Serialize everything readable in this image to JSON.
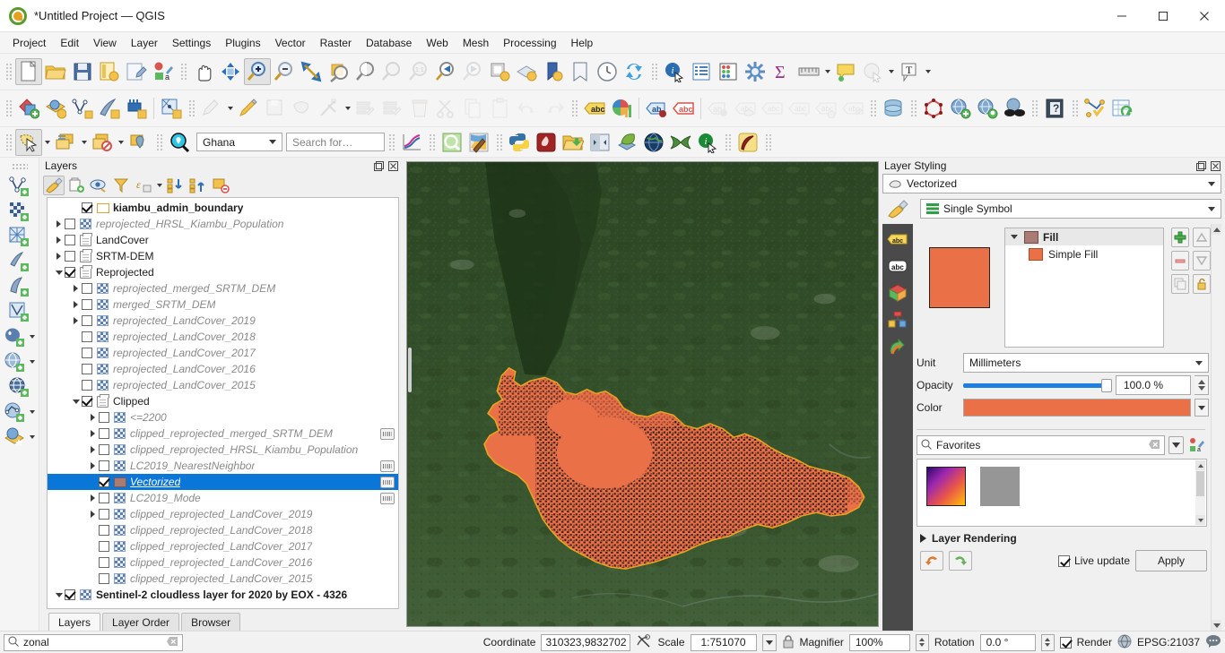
{
  "window": {
    "title": "*Untitled Project — QGIS",
    "logo_icon": "qgis-logo-icon",
    "minimize_icon": "minimize-icon",
    "maximize_icon": "maximize-icon",
    "close_icon": "close-icon"
  },
  "menubar": [
    {
      "label": "Project"
    },
    {
      "label": "Edit"
    },
    {
      "label": "View"
    },
    {
      "label": "Layer"
    },
    {
      "label": "Settings"
    },
    {
      "label": "Plugins"
    },
    {
      "label": "Vector"
    },
    {
      "label": "Raster"
    },
    {
      "label": "Database"
    },
    {
      "label": "Web"
    },
    {
      "label": "Mesh"
    },
    {
      "label": "Processing"
    },
    {
      "label": "Help"
    }
  ],
  "toolbar_row1": [
    {
      "icon": "new-project-icon",
      "active": true
    },
    {
      "icon": "open-project-icon"
    },
    {
      "icon": "save-project-icon"
    },
    {
      "icon": "save-project-as-icon"
    },
    {
      "icon": "new-print-layout-icon"
    },
    {
      "icon": "style-manager-icon"
    },
    {
      "icon": "pan-map-icon"
    },
    {
      "icon": "pan-to-selection-icon"
    },
    {
      "icon": "zoom-in-icon",
      "active": true
    },
    {
      "icon": "zoom-out-icon"
    },
    {
      "icon": "zoom-full-icon"
    },
    {
      "icon": "zoom-to-selection-icon"
    },
    {
      "icon": "zoom-to-layer-icon"
    },
    {
      "icon": "zoom-native-resolution-icon"
    },
    {
      "icon": "zoom-last-icon"
    },
    {
      "icon": "zoom-next-icon"
    },
    {
      "icon": "new-map-view-icon"
    },
    {
      "icon": "new-3d-map-view-icon"
    },
    {
      "icon": "show-bookmarks-icon"
    },
    {
      "icon": "new-bookmark-icon"
    },
    {
      "icon": "temporal-controller-icon"
    },
    {
      "icon": "refresh-icon"
    },
    {
      "icon": "identify-features-icon"
    },
    {
      "icon": "open-attribute-table-icon"
    },
    {
      "icon": "statistical-summary-icon"
    },
    {
      "icon": "processing-toolbox-icon"
    },
    {
      "icon": "sum-field-icon"
    },
    {
      "icon": "measure-line-icon"
    },
    {
      "icon": "map-tips-icon"
    },
    {
      "icon": "show-annotations-icon"
    },
    {
      "icon": "text-annotation-icon"
    }
  ],
  "toolbar_row2": [
    {
      "icon": "add-vector-layer-icon"
    },
    {
      "icon": "add-raster-layer-icon"
    },
    {
      "icon": "add-delimited-text-layer-icon"
    },
    {
      "icon": "add-spatialite-layer-icon"
    },
    {
      "icon": "add-virtual-layer-icon"
    },
    {
      "icon": "add-mesh-layer-icon"
    },
    {
      "icon": "current-edits-icon"
    },
    {
      "icon": "toggle-editing-icon"
    },
    {
      "icon": "save-layer-edits-icon"
    },
    {
      "icon": "add-polygon-feature-icon"
    },
    {
      "icon": "vertex-tool-icon"
    },
    {
      "icon": "modify-attributes-icon"
    },
    {
      "icon": "multi-edit-icon"
    },
    {
      "icon": "delete-selected-icon"
    },
    {
      "icon": "cut-features-icon"
    },
    {
      "icon": "copy-features-icon"
    },
    {
      "icon": "paste-features-icon"
    },
    {
      "icon": "undo-icon"
    },
    {
      "icon": "redo-icon"
    },
    {
      "icon": "label-layer-icon"
    },
    {
      "icon": "diagram-icon"
    },
    {
      "icon": "pin-labels-icon"
    },
    {
      "icon": "highlight-labels-icon"
    },
    {
      "icon": "move-label-icon"
    },
    {
      "icon": "show-hide-labels-icon"
    },
    {
      "icon": "rotate-label-icon"
    },
    {
      "icon": "change-label-icon"
    },
    {
      "icon": "label-properties-icon"
    },
    {
      "icon": "edit-label-icon"
    },
    {
      "icon": "database-manager-icon"
    },
    {
      "icon": "geometry-checker-icon"
    },
    {
      "icon": "metasearch-add-icon"
    },
    {
      "icon": "metasearch-find-icon"
    },
    {
      "icon": "openstreetmap-icon"
    },
    {
      "icon": "help-contents-icon"
    },
    {
      "icon": "topology-checker-icon"
    },
    {
      "icon": "refresh-table-icon"
    }
  ],
  "toolbar_row3": {
    "left_buttons": [
      {
        "icon": "select-features-icon",
        "active": true
      },
      {
        "icon": "deselect-features-icon"
      },
      {
        "icon": "select-by-expression-icon"
      },
      {
        "icon": "select-by-location-icon"
      }
    ],
    "search_zone_icon": "magnifier-blue-icon",
    "country_combo": {
      "value": "Ghana",
      "options": [
        "Ghana"
      ]
    },
    "search_input": {
      "value": "",
      "placeholder": "Search for…"
    },
    "right_buttons": [
      {
        "icon": "plot-chart-icon"
      },
      {
        "icon": "zoom-green-icon"
      },
      {
        "icon": "paint-style-icon"
      },
      {
        "icon": "python-console-icon"
      },
      {
        "icon": "freehand-red-icon"
      },
      {
        "icon": "open-folder-icon"
      },
      {
        "icon": "compare-split-icon"
      },
      {
        "icon": "leaf-layers-icon"
      },
      {
        "icon": "globe-dark-icon"
      },
      {
        "icon": "green-bowtie-icon"
      },
      {
        "icon": "info-green-icon"
      },
      {
        "icon": "lasso-yellow-icon"
      }
    ]
  },
  "left_dock": [
    {
      "icon": "add-vector-layer-icon",
      "caret": false
    },
    {
      "icon": "add-raster-layer-icon",
      "caret": false
    },
    {
      "icon": "add-mesh-layer-icon",
      "caret": false
    },
    {
      "icon": "add-delimited-text-layer-icon",
      "caret": false
    },
    {
      "icon": "add-spatialite-layer-icon",
      "caret": false
    },
    {
      "icon": "add-virtual-layer-icon",
      "caret": false
    },
    {
      "icon": "add-postgis-layer-icon",
      "caret": true
    },
    {
      "icon": "add-wms-layer-icon",
      "caret": true
    },
    {
      "icon": "add-wcs-layer-icon",
      "caret": false
    },
    {
      "icon": "add-wfs-layer-icon",
      "caret": true
    },
    {
      "icon": "add-arcgis-layer-icon",
      "caret": true
    }
  ],
  "layers_panel": {
    "title": "Layers",
    "float_icon": "undock-icon",
    "close_icon": "close-panel-icon",
    "toolbar": [
      {
        "icon": "open-layer-styling-icon",
        "active": true
      },
      {
        "icon": "add-group-icon",
        "active": false
      },
      {
        "icon": "manage-map-themes-icon",
        "active": false
      },
      {
        "icon": "filter-legend-icon",
        "active": false
      },
      {
        "icon": "filter-legend-expression-icon",
        "active": false,
        "caret": true
      },
      {
        "icon": "expand-all-icon",
        "active": false
      },
      {
        "icon": "collapse-all-icon",
        "active": false
      },
      {
        "icon": "remove-layer-icon",
        "active": false
      }
    ],
    "tree": [
      {
        "name": "kiambu_admin_boundary",
        "indent": 1,
        "checked": true,
        "expander": "none",
        "icon": "empty-polygon-swatch",
        "style": "bold",
        "chip": false
      },
      {
        "name": "reprojected_HRSL_Kiambu_Population",
        "indent": 0,
        "checked": false,
        "expander": "collapsed",
        "icon": "raster",
        "style": "italic-grey",
        "chip": false
      },
      {
        "name": "LandCover",
        "indent": 0,
        "checked": false,
        "expander": "collapsed",
        "icon": "group",
        "style": "plain",
        "chip": false
      },
      {
        "name": "SRTM-DEM",
        "indent": 0,
        "checked": false,
        "expander": "collapsed",
        "icon": "group",
        "style": "plain",
        "chip": false
      },
      {
        "name": "Reprojected",
        "indent": 0,
        "checked": true,
        "expander": "expanded",
        "icon": "group",
        "style": "plain",
        "chip": false
      },
      {
        "name": "reprojected_merged_SRTM_DEM",
        "indent": 1,
        "checked": false,
        "expander": "collapsed",
        "icon": "raster",
        "style": "italic-grey",
        "chip": false
      },
      {
        "name": "merged_SRTM_DEM",
        "indent": 1,
        "checked": false,
        "expander": "collapsed",
        "icon": "raster",
        "style": "italic-grey",
        "chip": false
      },
      {
        "name": "reprojected_LandCover_2019",
        "indent": 1,
        "checked": false,
        "expander": "collapsed",
        "icon": "raster",
        "style": "italic-grey",
        "chip": false
      },
      {
        "name": "reprojected_LandCover_2018",
        "indent": 1,
        "checked": false,
        "expander": "none",
        "icon": "raster",
        "style": "italic-grey",
        "chip": false
      },
      {
        "name": "reprojected_LandCover_2017",
        "indent": 1,
        "checked": false,
        "expander": "none",
        "icon": "raster",
        "style": "italic-grey",
        "chip": false
      },
      {
        "name": "reprojected_LandCover_2016",
        "indent": 1,
        "checked": false,
        "expander": "none",
        "icon": "raster",
        "style": "italic-grey",
        "chip": false
      },
      {
        "name": "reprojected_LandCover_2015",
        "indent": 1,
        "checked": false,
        "expander": "none",
        "icon": "raster",
        "style": "italic-grey",
        "chip": false
      },
      {
        "name": "Clipped",
        "indent": 1,
        "checked": true,
        "expander": "expanded",
        "icon": "group",
        "style": "plain",
        "chip": false
      },
      {
        "name": "<=2200",
        "indent": 2,
        "checked": false,
        "expander": "collapsed",
        "icon": "raster",
        "style": "italic-grey",
        "chip": false
      },
      {
        "name": "clipped_reprojected_merged_SRTM_DEM",
        "indent": 2,
        "checked": false,
        "expander": "collapsed",
        "icon": "raster",
        "style": "italic-grey",
        "chip": true
      },
      {
        "name": "clipped_reprojected_HRSL_Kiambu_Population",
        "indent": 2,
        "checked": false,
        "expander": "collapsed",
        "icon": "raster",
        "style": "italic-grey",
        "chip": false
      },
      {
        "name": "LC2019_NearestNeighbor",
        "indent": 2,
        "checked": false,
        "expander": "collapsed",
        "icon": "raster",
        "style": "italic-grey",
        "chip": true
      },
      {
        "name": "Vectorized",
        "indent": 2,
        "checked": true,
        "expander": "none",
        "icon": "polygon-swatch",
        "style": "selected",
        "chip": true,
        "selected": true
      },
      {
        "name": "LC2019_Mode",
        "indent": 2,
        "checked": false,
        "expander": "collapsed",
        "icon": "raster",
        "style": "italic-grey",
        "chip": true
      },
      {
        "name": "clipped_reprojected_LandCover_2019",
        "indent": 2,
        "checked": false,
        "expander": "collapsed",
        "icon": "raster",
        "style": "italic-grey",
        "chip": false
      },
      {
        "name": "clipped_reprojected_LandCover_2018",
        "indent": 2,
        "checked": false,
        "expander": "none",
        "icon": "raster",
        "style": "italic-grey",
        "chip": false
      },
      {
        "name": "clipped_reprojected_LandCover_2017",
        "indent": 2,
        "checked": false,
        "expander": "none",
        "icon": "raster",
        "style": "italic-grey",
        "chip": false
      },
      {
        "name": "clipped_reprojected_LandCover_2016",
        "indent": 2,
        "checked": false,
        "expander": "none",
        "icon": "raster",
        "style": "italic-grey",
        "chip": false
      },
      {
        "name": "clipped_reprojected_LandCover_2015",
        "indent": 2,
        "checked": false,
        "expander": "none",
        "icon": "raster",
        "style": "italic-grey",
        "chip": false
      },
      {
        "name": "Sentinel-2 cloudless layer for 2020 by EOX - 4326",
        "indent": 0,
        "checked": true,
        "expander": "expanded",
        "icon": "raster",
        "style": "bold",
        "chip": false
      }
    ],
    "tabs": [
      {
        "label": "Layers",
        "active": true
      },
      {
        "label": "Layer Order",
        "active": false
      },
      {
        "label": "Browser",
        "active": false
      }
    ]
  },
  "styling_panel": {
    "title": "Layer Styling",
    "float_icon": "undock-icon",
    "close_icon": "close-panel-icon",
    "layer_combo": {
      "value": "Vectorized",
      "icon": "polygon-layer-icon"
    },
    "renderer_combo": {
      "value": "Single Symbol",
      "icon": "single-symbol-icon"
    },
    "vtabs": [
      {
        "icon": "labels-yellow-icon"
      },
      {
        "icon": "masks-abc-icon"
      },
      {
        "icon": "3d-view-icon"
      },
      {
        "icon": "diagrams-icon"
      },
      {
        "icon": "action-arrow-icon"
      }
    ],
    "symbol_tree": [
      {
        "label": "Fill",
        "level": 0,
        "swatch": "fill-swatch"
      },
      {
        "label": "Simple Fill",
        "level": 1,
        "swatch": "simple-fill-swatch"
      }
    ],
    "symbol_buttons": [
      {
        "icon": "add-symbol-layer-icon"
      },
      {
        "icon": "move-up-icon"
      },
      {
        "icon": "remove-symbol-layer-icon"
      },
      {
        "icon": "move-down-icon"
      },
      {
        "icon": "duplicate-symbol-layer-icon"
      },
      {
        "icon": "lock-layer-icon"
      }
    ],
    "properties": {
      "unit_label": "Unit",
      "unit_value": "Millimeters",
      "opacity_label": "Opacity",
      "opacity_value": "100.0 %",
      "color_label": "Color",
      "color_hex": "#ea7048"
    },
    "favorites": {
      "search_icon": "search-icon",
      "value": "Favorites",
      "clear_icon": "clear-icon",
      "dropdown_icon": "chevron-down-icon",
      "style_manager_icon": "style-manager-small-icon"
    },
    "gallery": [
      {
        "name": "gradient-swatch"
      },
      {
        "name": "grey-swatch"
      }
    ],
    "layer_rendering_label": "Layer Rendering",
    "footer": {
      "undo_icon": "undo-orange-icon",
      "redo_icon": "redo-green-icon",
      "live_update_label": "Live update",
      "live_update_checked": true,
      "apply_label": "Apply"
    }
  },
  "map": {
    "symbol_color": "#ea7048",
    "outline_color": "#e8a41f",
    "base_color": "#2e4a28"
  },
  "statusbar": {
    "locator": {
      "icon": "search-icon",
      "value": "zonal",
      "clear_icon": "clear-icon"
    },
    "coordinate_label": "Coordinate",
    "coordinate_value": "310323,9832702",
    "toggle_extents_icon": "toggle-extents-icon",
    "scale_label": "Scale",
    "scale_value": "1:751070",
    "lock_icon": "lock-scale-icon",
    "magnifier_label": "Magnifier",
    "magnifier_value": "100%",
    "rotation_label": "Rotation",
    "rotation_value": "0.0 °",
    "render_label": "Render",
    "render_checked": true,
    "crs_icon": "crs-globe-icon",
    "crs_value": "EPSG:21037",
    "messages_icon": "messages-icon"
  }
}
